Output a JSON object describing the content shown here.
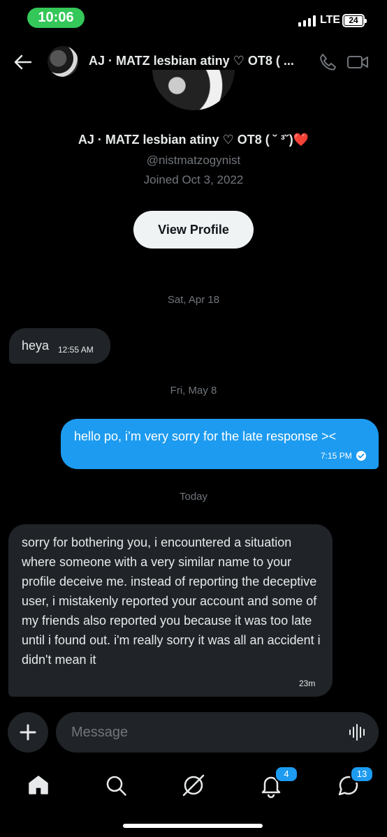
{
  "status_bar": {
    "time": "10:06",
    "network": "LTE",
    "battery": "24"
  },
  "header": {
    "title": "AJ · MATZ lesbian atiny ♡ OT8 ( ..."
  },
  "profile": {
    "name": "AJ · MATZ lesbian atiny ♡ OT8 ( ˘ ³˘)",
    "name_emoji": "❤️",
    "handle": "@nistmatzogynist",
    "joined": "Joined Oct 3, 2022",
    "view_profile_label": "View Profile"
  },
  "messages": [
    {
      "date": "Sat, Apr 18",
      "direction": "incoming",
      "text": "heya",
      "time": "12:55 AM"
    },
    {
      "date": "Fri, May 8",
      "direction": "outgoing",
      "text": "hello po, i’m very sorry for the late response ><",
      "time": "7:15 PM",
      "seen": true
    },
    {
      "date": "Today",
      "direction": "incoming",
      "text": "sorry for bothering you, i encountered a situation where someone with a very similar name to your profile deceive me. instead of reporting the deceptive user, i mistakenly reported your account and some of my friends also reported you because it was too late until i found out. i'm really sorry it was all an accident i didn't mean it",
      "time": "23m"
    }
  ],
  "compose": {
    "placeholder": "Message"
  },
  "nav": {
    "notifications_badge": "4",
    "messages_badge": "13"
  },
  "colors": {
    "accent": "#1d9bf0",
    "background": "#000000",
    "bubble_incoming": "#202327",
    "time_pill": "#34c759"
  }
}
